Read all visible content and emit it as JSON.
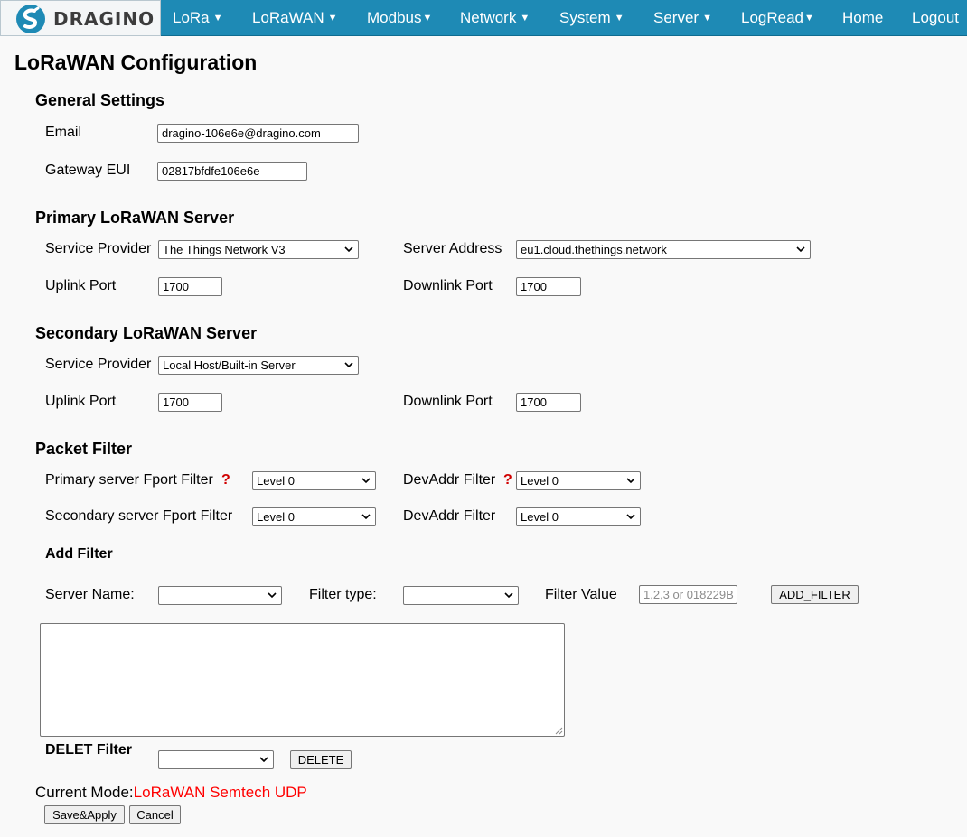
{
  "brand": {
    "name": "DRAGINO"
  },
  "nav": {
    "lora": "LoRa",
    "lorawan": "LoRaWAN",
    "modbus": "Modbus",
    "network": "Network",
    "system": "System",
    "server": "Server",
    "logread": "LogRead",
    "home": "Home",
    "logout": "Logout"
  },
  "page": {
    "title": "LoRaWAN Configuration"
  },
  "general": {
    "heading": "General Settings",
    "email_label": "Email",
    "email_value": "dragino-106e6e@dragino.com",
    "eui_label": "Gateway EUI",
    "eui_value": "02817bfdfe106e6e"
  },
  "primary": {
    "heading": "Primary LoRaWAN Server",
    "provider_label": "Service Provider",
    "provider_value": "The Things Network V3",
    "address_label": "Server Address",
    "address_value": "eu1.cloud.thethings.network",
    "uplink_label": "Uplink Port",
    "uplink_value": "1700",
    "downlink_label": "Downlink Port",
    "downlink_value": "1700"
  },
  "secondary": {
    "heading": "Secondary LoRaWAN Server",
    "provider_label": "Service Provider",
    "provider_value": "Local Host/Built-in Server",
    "uplink_label": "Uplink Port",
    "uplink_value": "1700",
    "downlink_label": "Downlink Port",
    "downlink_value": "1700"
  },
  "packet_filter": {
    "heading": "Packet Filter",
    "primary_fport_label": "Primary server Fport Filter",
    "primary_fport_value": "Level 0",
    "primary_devaddr_label": "DevAddr Filter",
    "primary_devaddr_value": "Level 0",
    "secondary_fport_label": "Secondary server Fport Filter",
    "secondary_fport_value": "Level 0",
    "secondary_devaddr_label": "DevAddr Filter",
    "secondary_devaddr_value": "Level 0",
    "help_glyph": "?",
    "add_heading": "Add Filter",
    "server_name_label": "Server Name:",
    "server_name_value": "",
    "filter_type_label": "Filter type:",
    "filter_type_value": "",
    "filter_value_label": "Filter Value",
    "filter_value_placeholder": "1,2,3 or 018229B",
    "add_button": "ADD_FILTER",
    "delete_heading": "DELET Filter",
    "delete_value": "",
    "delete_button": "DELETE"
  },
  "footer": {
    "mode_label": "Current Mode:",
    "mode_value": "LoRaWAN Semtech UDP",
    "save_button": "Save&Apply",
    "cancel_button": "Cancel"
  },
  "colors": {
    "nav_bg": "#1e8ab5",
    "mode_red": "#ff0000",
    "help_red": "#d00000"
  }
}
